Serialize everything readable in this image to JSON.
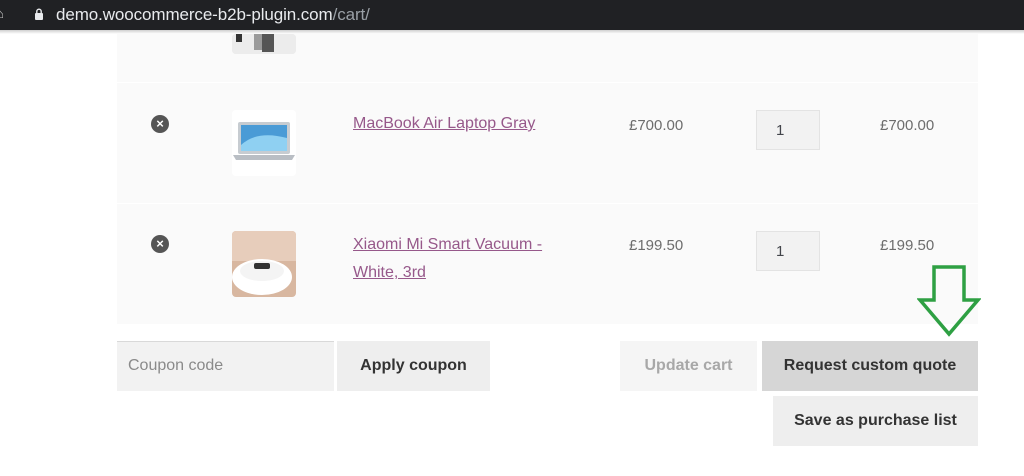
{
  "browser": {
    "url_host": "demo.woocommerce-b2b-plugin.com",
    "url_path": "/cart/"
  },
  "cart": {
    "items": [
      {
        "name": "MacBook Air Laptop Gray",
        "price": "£700.00",
        "quantity": "1",
        "subtotal": "£700.00"
      },
      {
        "name_line1": "Xiaomi Mi Smart Vacuum -",
        "name_line2": "White, 3rd",
        "price": "£199.50",
        "quantity": "1",
        "subtotal": "£199.50"
      }
    ],
    "remove_icon": "×"
  },
  "actions": {
    "coupon_placeholder": "Coupon code",
    "apply_coupon": "Apply coupon",
    "update_cart": "Update cart",
    "request_quote": "Request custom quote",
    "save_purchase_list": "Save as purchase list"
  },
  "colors": {
    "link": "#96588a",
    "annotation_arrow": "#2ea043"
  },
  "icons": {
    "lock": "lock-icon",
    "remove": "remove-circle-icon",
    "arrow": "down-arrow-annotation"
  }
}
